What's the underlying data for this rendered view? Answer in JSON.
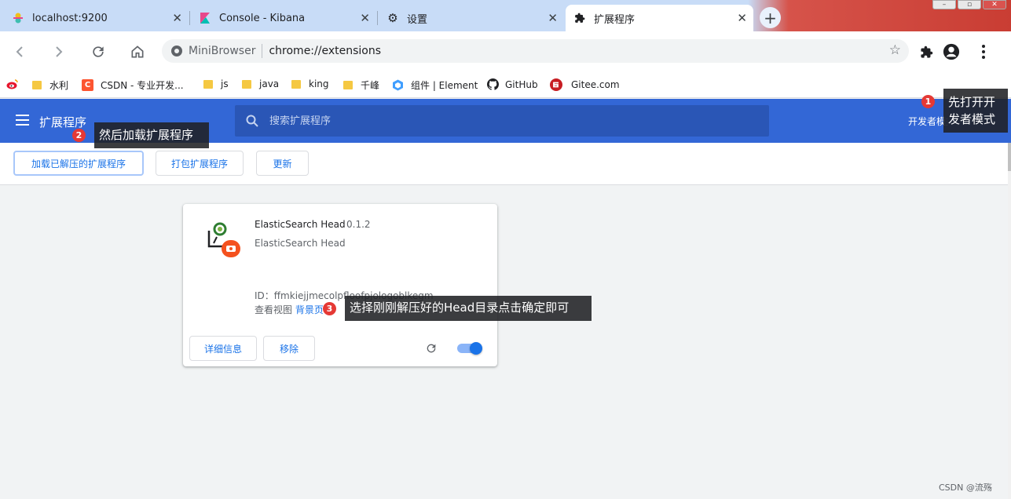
{
  "browser": {
    "tabs": [
      {
        "label": "localhost:9200",
        "icon": "elastic-icon"
      },
      {
        "label": "Console - Kibana",
        "icon": "kibana-icon"
      },
      {
        "label": "设置",
        "icon": "gear-icon"
      },
      {
        "label": "扩展程序",
        "icon": "puzzle-icon"
      }
    ],
    "new_tab_label": "+",
    "omnibox": {
      "site": "MiniBrowser",
      "url": "chrome://extensions"
    },
    "bookmarks": [
      {
        "label": "",
        "icon": "weibo-icon"
      },
      {
        "label": "水利",
        "icon": "folder-icon"
      },
      {
        "label": "CSDN - 专业开发...",
        "icon": "csdn-icon"
      },
      {
        "label": "js",
        "icon": "folder-icon"
      },
      {
        "label": "java",
        "icon": "folder-icon"
      },
      {
        "label": "king",
        "icon": "folder-icon"
      },
      {
        "label": "千峰",
        "icon": "folder-icon"
      },
      {
        "label": "组件 | Element",
        "icon": "element-icon"
      },
      {
        "label": "GitHub",
        "icon": "github-icon"
      },
      {
        "label": "Gitee.com",
        "icon": "gitee-icon"
      }
    ]
  },
  "page": {
    "title": "扩展程序",
    "search_placeholder": "搜索扩展程序",
    "dev_mode_label": "开发者模式",
    "actions": {
      "load_unpacked": "加载已解压的扩展程序",
      "pack": "打包扩展程序",
      "update": "更新"
    },
    "extension": {
      "name": "ElasticSearch Head",
      "version": "0.1.2",
      "description": "ElasticSearch Head",
      "id_label": "ID：",
      "id": "ffmkiejjmecolpfloofpjologoblkegm",
      "views_label": "查看视图",
      "views_link": "背景页",
      "details_button": "详细信息",
      "remove_button": "移除",
      "enabled": true
    }
  },
  "annotations": [
    {
      "num": "1",
      "text": "先打开开发者模式"
    },
    {
      "num": "2",
      "text": "然后加载扩展程序"
    },
    {
      "num": "3",
      "text": "选择刚刚解压好的Head目录点击确定即可"
    }
  ],
  "watermark": "CSDN @流殇",
  "colors": {
    "header": "#3367d6",
    "accent": "#1a73e8",
    "annotation_badge": "#e53935"
  }
}
